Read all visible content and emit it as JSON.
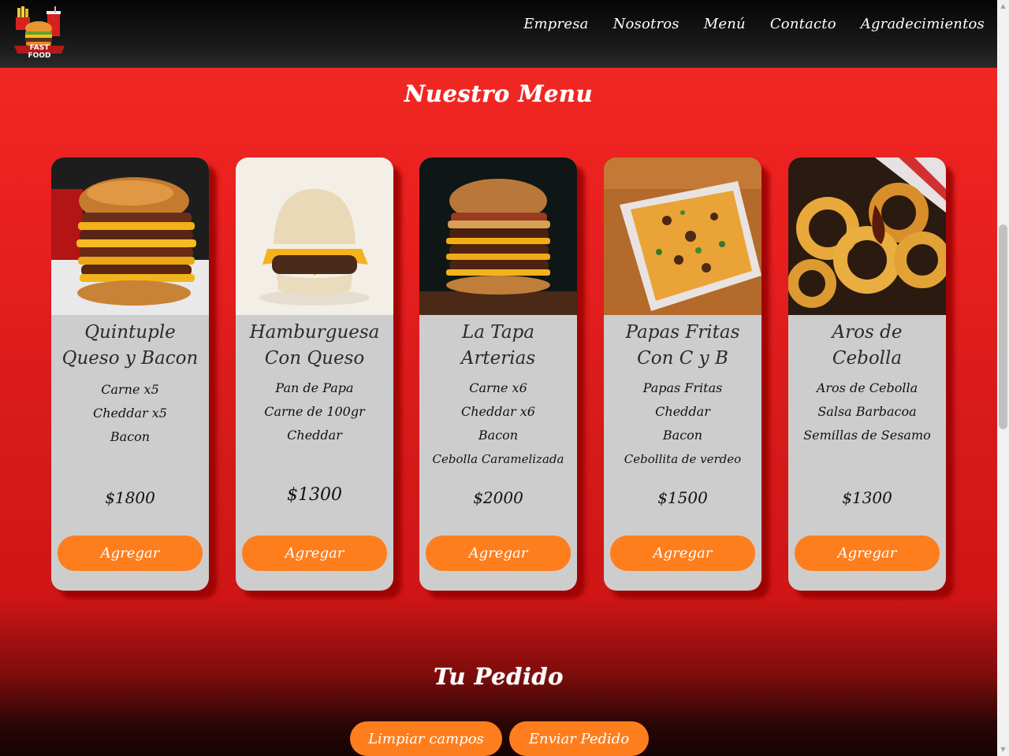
{
  "nav": {
    "logo_text": "FAST FOOD",
    "links": [
      "Empresa",
      "Nosotros",
      "Menú",
      "Contacto",
      "Agradecimientos"
    ]
  },
  "menu": {
    "title": "Nuestro Menu",
    "items": [
      {
        "name": "Quintuple Queso y Bacon",
        "ingredients": [
          "Carne x5",
          "Cheddar x5",
          "Bacon"
        ],
        "price": "$1800",
        "button": "Agregar",
        "image": "burger-tower-photo"
      },
      {
        "name": "Hamburguesa Con Queso",
        "ingredients": [
          "Pan de Papa",
          "Carne de 100gr",
          "Cheddar"
        ],
        "price": "$1300",
        "button": "Agregar",
        "image": "cheeseburger-photo"
      },
      {
        "name": "La Tapa Arterias",
        "ingredients": [
          "Carne x6",
          "Cheddar x6",
          "Bacon",
          "Cebolla Caramelizada"
        ],
        "price": "$2000",
        "button": "Agregar",
        "image": "stacked-burger-photo"
      },
      {
        "name": "Papas Fritas Con C y B",
        "ingredients": [
          "Papas Fritas",
          "Cheddar",
          "Bacon",
          "Cebollita de verdeo"
        ],
        "price": "$1500",
        "button": "Agregar",
        "image": "loaded-fries-photo"
      },
      {
        "name": "Aros de Cebolla",
        "ingredients": [
          "Aros de Cebolla",
          "Salsa Barbacoa",
          "Semillas de Sesamo"
        ],
        "price": "$1300",
        "button": "Agregar",
        "image": "onion-rings-photo"
      }
    ]
  },
  "order": {
    "title": "Tu Pedido",
    "clear_button": "Limpiar campos",
    "send_button": "Enviar Pedido"
  },
  "colors": {
    "accent": "#fe7e1e",
    "background_red": "#e81f1f",
    "card_bg": "#cdcdcd",
    "navbar": "#111111"
  }
}
